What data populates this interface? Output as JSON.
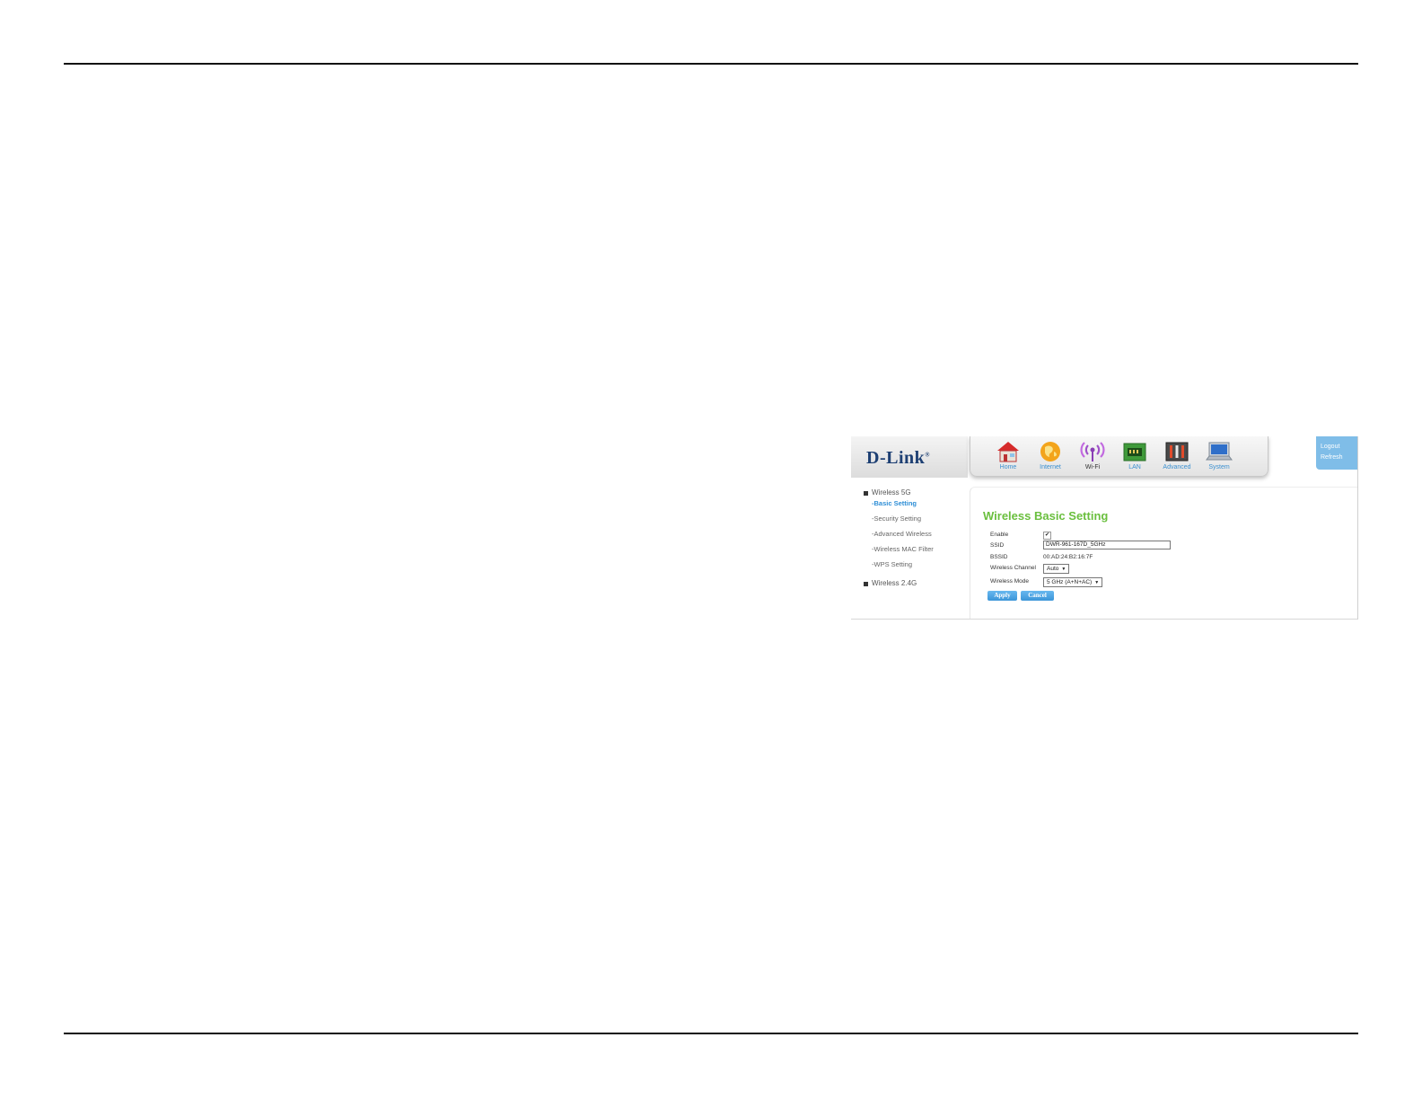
{
  "brand": {
    "logo": "D-Link"
  },
  "nav": [
    {
      "label": "Home",
      "icon": "home-icon"
    },
    {
      "label": "Internet",
      "icon": "globe-icon"
    },
    {
      "label": "Wi-Fi",
      "icon": "wifi-icon"
    },
    {
      "label": "LAN",
      "icon": "lan-icon"
    },
    {
      "label": "Advanced",
      "icon": "advanced-tools-icon"
    },
    {
      "label": "System",
      "icon": "laptop-icon"
    }
  ],
  "topright": {
    "logout": "Logout",
    "refresh": "Refresh"
  },
  "sidebar": {
    "group1": "Wireless 5G",
    "items": [
      {
        "label": "-Basic Setting"
      },
      {
        "label": "-Security Setting"
      },
      {
        "label": "-Advanced Wireless"
      },
      {
        "label": "-Wireless MAC Filter"
      },
      {
        "label": "-WPS Setting"
      }
    ],
    "group2": "Wireless 2.4G"
  },
  "form": {
    "title": "Wireless Basic Setting",
    "enable_label": "Enable",
    "enable_checked": "✔",
    "ssid_label": "SSID",
    "ssid_value": "DWR-961-167D_5GHz",
    "bssid_label": "BSSID",
    "bssid_value": "00:AD:24:B2:16:7F",
    "channel_label": "Wireless Channel",
    "channel_value": "Auto",
    "mode_label": "Wireless Mode",
    "mode_value": "5 GHz (A+N+AC)",
    "apply": "Apply",
    "cancel": "Cancel"
  },
  "colors": {
    "accent_blue": "#3b95d8",
    "title_green": "#6abf3e",
    "logo_navy": "#1d3f73"
  }
}
